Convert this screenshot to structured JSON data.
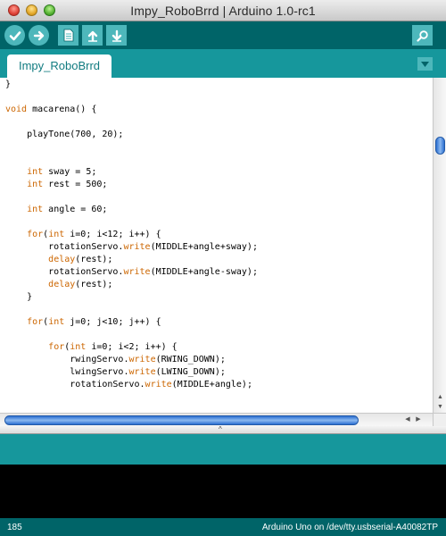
{
  "window": {
    "title": "Impy_RoboBrrd | Arduino 1.0-rc1"
  },
  "toolbar": {
    "buttons": [
      {
        "name": "verify",
        "icon": "check-icon"
      },
      {
        "name": "upload",
        "icon": "arrow-right-icon"
      },
      {
        "name": "new",
        "icon": "document-icon"
      },
      {
        "name": "open",
        "icon": "arrow-up-icon"
      },
      {
        "name": "save",
        "icon": "arrow-down-icon"
      }
    ],
    "serial_monitor_icon": "magnifier-icon"
  },
  "tabs": [
    {
      "label": "Impy_RoboBrrd",
      "active": true
    }
  ],
  "tab_menu_icon": "triangle-down-icon",
  "editor": {
    "lines": [
      [
        {
          "t": "}"
        }
      ],
      [
        {
          "t": ""
        }
      ],
      [
        {
          "t": "void",
          "kw": true
        },
        {
          "t": " macarena() {"
        }
      ],
      [
        {
          "t": ""
        }
      ],
      [
        {
          "t": "    playTone(700, 20);"
        }
      ],
      [
        {
          "t": ""
        }
      ],
      [
        {
          "t": ""
        }
      ],
      [
        {
          "t": "    "
        },
        {
          "t": "int",
          "kw": true
        },
        {
          "t": " sway = 5;"
        }
      ],
      [
        {
          "t": "    "
        },
        {
          "t": "int",
          "kw": true
        },
        {
          "t": " rest = 500;"
        }
      ],
      [
        {
          "t": ""
        }
      ],
      [
        {
          "t": "    "
        },
        {
          "t": "int",
          "kw": true
        },
        {
          "t": " angle = 60;"
        }
      ],
      [
        {
          "t": ""
        }
      ],
      [
        {
          "t": "    "
        },
        {
          "t": "for",
          "kw": true
        },
        {
          "t": "("
        },
        {
          "t": "int",
          "kw": true
        },
        {
          "t": " i=0; i<12; i++) {"
        }
      ],
      [
        {
          "t": "        rotationServo."
        },
        {
          "t": "write",
          "kw": true
        },
        {
          "t": "(MIDDLE+angle+sway);"
        }
      ],
      [
        {
          "t": "        "
        },
        {
          "t": "delay",
          "kw": true
        },
        {
          "t": "(rest);"
        }
      ],
      [
        {
          "t": "        rotationServo."
        },
        {
          "t": "write",
          "kw": true
        },
        {
          "t": "(MIDDLE+angle-sway);"
        }
      ],
      [
        {
          "t": "        "
        },
        {
          "t": "delay",
          "kw": true
        },
        {
          "t": "(rest);"
        }
      ],
      [
        {
          "t": "    }"
        }
      ],
      [
        {
          "t": ""
        }
      ],
      [
        {
          "t": "    "
        },
        {
          "t": "for",
          "kw": true
        },
        {
          "t": "("
        },
        {
          "t": "int",
          "kw": true
        },
        {
          "t": " j=0; j<10; j++) {"
        }
      ],
      [
        {
          "t": ""
        }
      ],
      [
        {
          "t": "        "
        },
        {
          "t": "for",
          "kw": true
        },
        {
          "t": "("
        },
        {
          "t": "int",
          "kw": true
        },
        {
          "t": " i=0; i<2; i++) {"
        }
      ],
      [
        {
          "t": "            rwingServo."
        },
        {
          "t": "write",
          "kw": true
        },
        {
          "t": "(RWING_DOWN);"
        }
      ],
      [
        {
          "t": "            lwingServo."
        },
        {
          "t": "write",
          "kw": true
        },
        {
          "t": "(LWING_DOWN);"
        }
      ],
      [
        {
          "t": "            rotationServo."
        },
        {
          "t": "write",
          "kw": true
        },
        {
          "t": "(MIDDLE+angle);"
        }
      ]
    ]
  },
  "colors": {
    "toolbar": "#006468",
    "tabbar": "#16979c",
    "button": "#4db7bb",
    "keyword": "#cc6600"
  },
  "status": {
    "line_number": "185",
    "board": "Arduino Uno on /dev/tty.usbserial-A40082TP"
  }
}
